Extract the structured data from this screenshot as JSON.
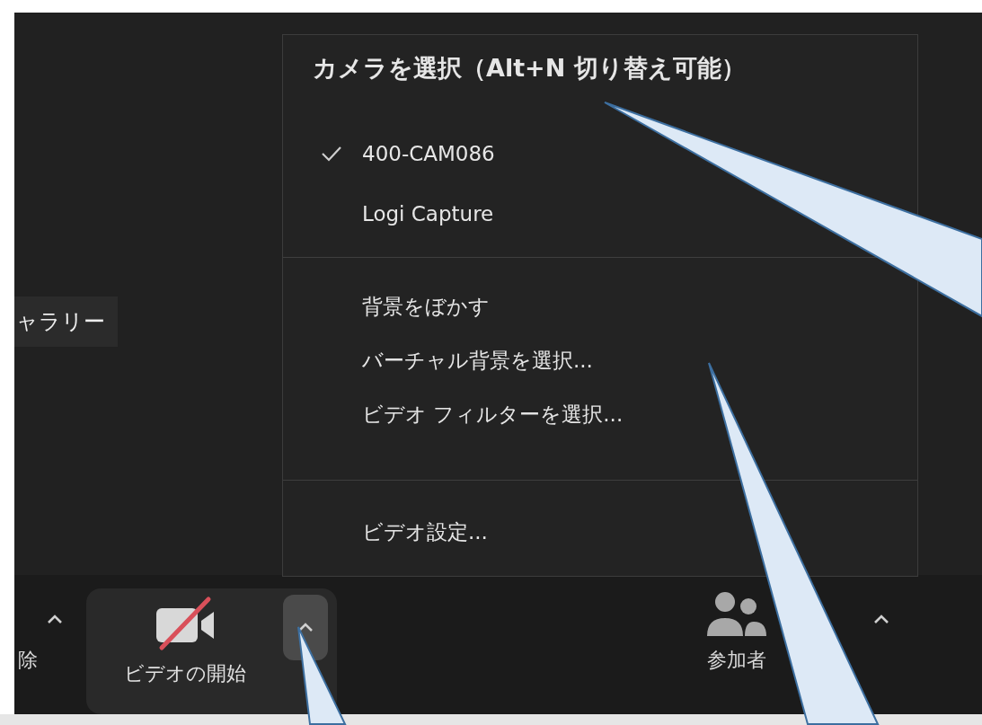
{
  "gallery_tab": {
    "label": "ャラリー"
  },
  "camera_menu": {
    "title": "カメラを選択（Alt+N 切り替え可能）",
    "cameras": [
      {
        "label": "400-CAM086",
        "selected": true
      },
      {
        "label": "Logi Capture",
        "selected": false
      }
    ],
    "background_items": [
      "背景をぼかす",
      "バーチャル背景を選択...",
      "ビデオ フィルターを選択..."
    ],
    "settings_items": [
      "ビデオ設定..."
    ]
  },
  "toolbar": {
    "items": [
      {
        "kind": "partial",
        "label": "除"
      },
      {
        "kind": "video",
        "label": "ビデオの開始",
        "muted": true,
        "menu_open": true
      },
      {
        "kind": "participants",
        "label": "参加者"
      }
    ]
  }
}
